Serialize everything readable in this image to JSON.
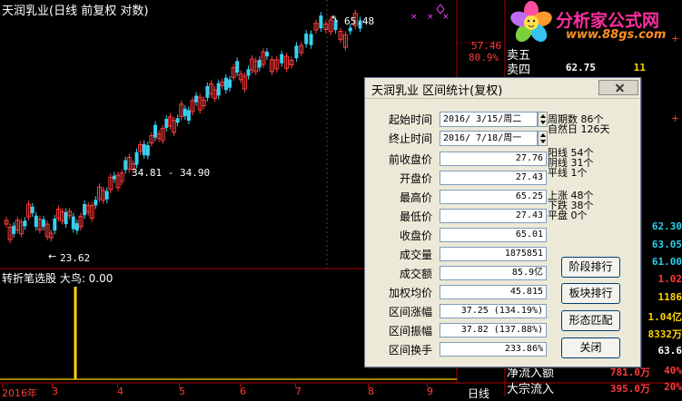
{
  "chart": {
    "title": "天润乳业(日线 前复权 对数)",
    "high_label": "65.48",
    "low_label": "23.62",
    "range_label": "34.81 - 34.90",
    "price_level": "57.46",
    "pct_level": "80.9%"
  },
  "indicator": {
    "label": "转折笔选股 大鸟: 0.00"
  },
  "xaxis": {
    "labels": [
      "2016年",
      "3",
      "4",
      "5",
      "6",
      "7",
      "8",
      "9"
    ],
    "period": "日线"
  },
  "right_panel": {
    "rows_top": [
      {
        "label": "卖五",
        "price": "",
        "vol": ""
      },
      {
        "label": "卖四",
        "price": "62.75",
        "vol": "11"
      }
    ],
    "right_numbers": [
      "62.30",
      "63.05",
      "61.00",
      "1.02",
      "1186",
      "1.04亿",
      "8332万",
      "63.6"
    ],
    "bottom_rows": [
      {
        "label": "净流入额",
        "value": "781.0万",
        "pct": "40%"
      },
      {
        "label": "大宗流入",
        "value": "395.0万",
        "pct": "20%"
      }
    ]
  },
  "watermark": {
    "title": "分析家公式网",
    "url": "www.88gs.com"
  },
  "dialog": {
    "title": "天润乳业 区间统计(复权)",
    "start_label": "起始时间",
    "start_value": "2016/ 3/15/周二",
    "end_label": "终止时间",
    "end_value": "2016/ 7/18/周一",
    "fields": [
      {
        "label": "前收盘价",
        "value": "27.76"
      },
      {
        "label": "开盘价",
        "value": "27.43"
      },
      {
        "label": "最高价",
        "value": "65.25"
      },
      {
        "label": "最低价",
        "value": "27.43"
      },
      {
        "label": "收盘价",
        "value": "65.01"
      },
      {
        "label": "成交量",
        "value": "1875851"
      },
      {
        "label": "成交额",
        "value": "85.9亿"
      },
      {
        "label": "加权均价",
        "value": "45.815"
      },
      {
        "label": "区间涨幅",
        "value": "37.25 (134.19%)"
      },
      {
        "label": "区间振幅",
        "value": "37.82 (137.88%)"
      },
      {
        "label": "区间换手",
        "value": "233.86%"
      }
    ],
    "stats_group1": [
      "周期数 86个",
      "自然日 126天"
    ],
    "stats_group2": [
      "阳线 54个",
      "阴线 31个",
      "平线 1个"
    ],
    "stats_group3": [
      "上涨 48个",
      "下跌 38个",
      "平盘 0个"
    ],
    "buttons": [
      "阶段排行",
      "板块排行",
      "形态匹配",
      "关闭"
    ]
  }
}
